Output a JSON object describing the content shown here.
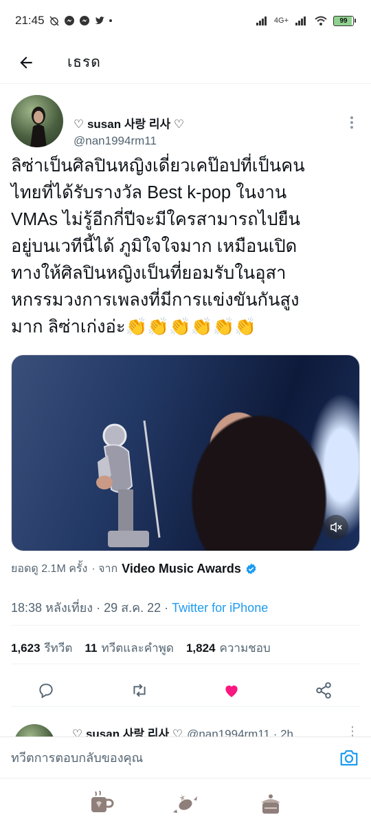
{
  "status_bar": {
    "time": "21:45",
    "network": "4G+",
    "battery": "99"
  },
  "header": {
    "title": "เธรด"
  },
  "tweet": {
    "author_name": "♡ susan 사랑 리사 ♡",
    "author_handle": "@nan1994rm11",
    "text": "ลิซ่าเป็นศิลปินหญิงเดี่ยวเคป๊อปที่เป็นคน\nไทยที่ได้รับรางวัล Best k-pop ในงาน\nVMAs ไม่รู้อีกกี่ปีจะมีใครสามารถไปยืน\nอยู่บนเวทีนี้ได้ ภูมิใจใจมาก เหมือนเปิด\nทางให้ศิลปินหญิงเป็นที่ยอมรับในอุสา\nหกรรมวงการเพลงที่มีการแข่งขันกันสูง\nมาก ลิซ่าเก่งอ่ะ👏👏👏👏👏👏",
    "views": "ยอดดู 2.1M ครั้ง",
    "from_label": "· จาก",
    "source": "Video Music Awards",
    "time": "18:38 หลังเที่ยง · 29 ส.ค. 22 · ",
    "client": "Twitter for iPhone",
    "retweets": "1,623",
    "retweets_label": "รีทวีต",
    "quotes": "11",
    "quotes_label": "ทวีตและคำพูด",
    "likes": "1,824",
    "likes_label": "ความชอบ"
  },
  "next_tweet": {
    "author_name": "♡ susan 사랑 리사 ♡",
    "meta": "@nan1994rm11 · 2h"
  },
  "reply": {
    "placeholder": "ทวีตการตอบกลับของคุณ"
  },
  "colors": {
    "accent": "#1d9bf0",
    "like": "#f91880",
    "text": "#0f1419",
    "secondary": "#536471"
  },
  "icons": {
    "back": "arrow-left-icon",
    "more": "more-vertical-icon",
    "mute": "speaker-muted-icon",
    "verified": "verified-badge-icon",
    "reply": "reply-icon",
    "retweet": "retweet-icon",
    "like": "heart-filled-icon",
    "share": "share-icon",
    "camera": "camera-icon"
  }
}
